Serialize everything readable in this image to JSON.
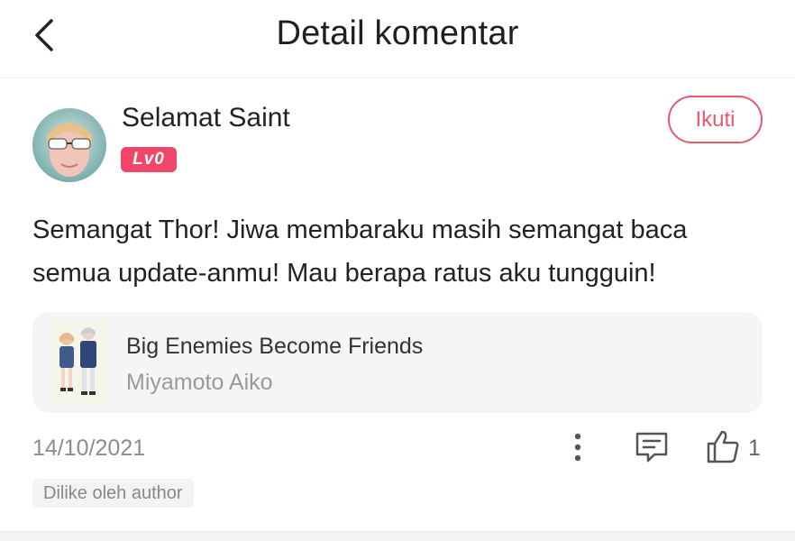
{
  "header": {
    "title": "Detail komentar"
  },
  "user": {
    "name": "Selamat Saint",
    "level": "Lv0"
  },
  "follow": {
    "label": "Ikuti"
  },
  "comment": {
    "text": "Semangat Thor! Jiwa membaraku masih semangat baca semua update-anmu! Mau berapa ratus aku tungguin!"
  },
  "book": {
    "title": "Big Enemies Become Friends",
    "author": "Miyamoto Aiko"
  },
  "meta": {
    "date": "14/10/2021",
    "like_count": "1",
    "liked_by": "Dilike oleh author"
  },
  "icons": {
    "back": "chevron-left-icon",
    "more": "more-vertical-icon",
    "reply": "comment-icon",
    "like": "thumbs-up-icon"
  },
  "colors": {
    "accent": "#e8586f",
    "badge": "#f0466a"
  }
}
